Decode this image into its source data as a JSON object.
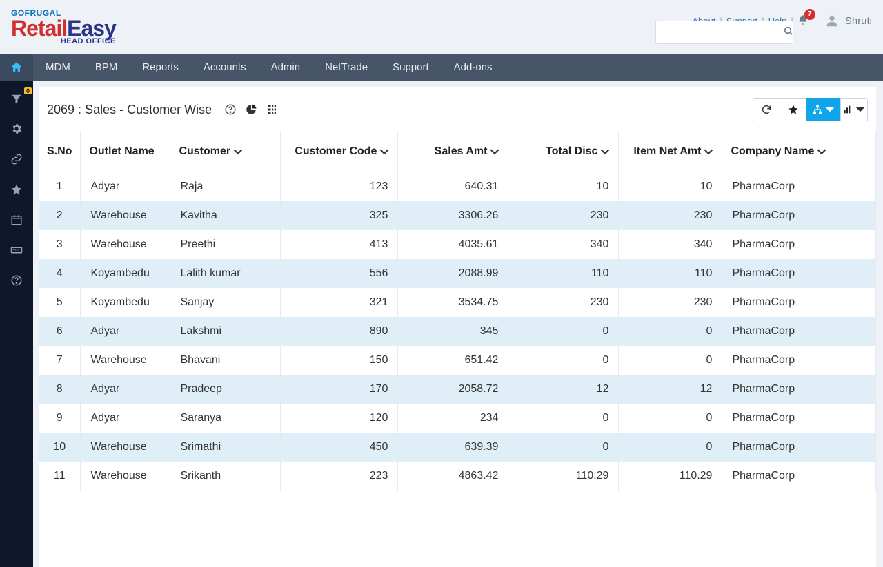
{
  "brand": {
    "gofrugal": "GOFRUGAL",
    "retail": "Retail",
    "easy": "Easy",
    "sub": "HEAD OFFICE"
  },
  "topLinks": {
    "about": "About",
    "support": "Support",
    "help": "Help"
  },
  "notifications": {
    "count": "7"
  },
  "user": {
    "name": "Shruti"
  },
  "nav": {
    "mdm": "MDM",
    "bpm": "BPM",
    "reports": "Reports",
    "accounts": "Accounts",
    "admin": "Admin",
    "nettrade": "NetTrade",
    "support": "Support",
    "addons": "Add-ons"
  },
  "rail": {
    "filterBadge": "0"
  },
  "report": {
    "title": "2069 : Sales - Customer Wise"
  },
  "columns": {
    "sno": "S.No",
    "outlet": "Outlet Name",
    "customer": "Customer",
    "code": "Customer Code",
    "sales": "Sales Amt",
    "disc": "Total Disc",
    "net": "Item Net Amt",
    "company": "Company Name"
  },
  "rows": [
    {
      "sno": "1",
      "outlet": "Adyar",
      "customer": "Raja",
      "code": "123",
      "sales": "640.31",
      "disc": "10",
      "net": "10",
      "company": "PharmaCorp"
    },
    {
      "sno": "2",
      "outlet": "Warehouse",
      "customer": "Kavitha",
      "code": "325",
      "sales": "3306.26",
      "disc": "230",
      "net": "230",
      "company": "PharmaCorp"
    },
    {
      "sno": "3",
      "outlet": "Warehouse",
      "customer": "Preethi",
      "code": "413",
      "sales": "4035.61",
      "disc": "340",
      "net": "340",
      "company": "PharmaCorp"
    },
    {
      "sno": "4",
      "outlet": "Koyambedu",
      "customer": "Lalith kumar",
      "code": "556",
      "sales": "2088.99",
      "disc": "110",
      "net": "110",
      "company": "PharmaCorp"
    },
    {
      "sno": "5",
      "outlet": "Koyambedu",
      "customer": "Sanjay",
      "code": "321",
      "sales": "3534.75",
      "disc": "230",
      "net": "230",
      "company": "PharmaCorp"
    },
    {
      "sno": "6",
      "outlet": "Adyar",
      "customer": "Lakshmi",
      "code": "890",
      "sales": "345",
      "disc": "0",
      "net": "0",
      "company": "PharmaCorp"
    },
    {
      "sno": "7",
      "outlet": "Warehouse",
      "customer": "Bhavani",
      "code": "150",
      "sales": "651.42",
      "disc": "0",
      "net": "0",
      "company": "PharmaCorp"
    },
    {
      "sno": "8",
      "outlet": "Adyar",
      "customer": "Pradeep",
      "code": "170",
      "sales": "2058.72",
      "disc": "12",
      "net": "12",
      "company": "PharmaCorp"
    },
    {
      "sno": "9",
      "outlet": "Adyar",
      "customer": "Saranya",
      "code": "120",
      "sales": "234",
      "disc": "0",
      "net": "0",
      "company": "PharmaCorp"
    },
    {
      "sno": "10",
      "outlet": "Warehouse",
      "customer": "Srimathi",
      "code": "450",
      "sales": "639.39",
      "disc": "0",
      "net": "0",
      "company": "PharmaCorp"
    },
    {
      "sno": "11",
      "outlet": "Warehouse",
      "customer": "Srikanth",
      "code": "223",
      "sales": "4863.42",
      "disc": "110.29",
      "net": "110.29",
      "company": "PharmaCorp"
    }
  ]
}
